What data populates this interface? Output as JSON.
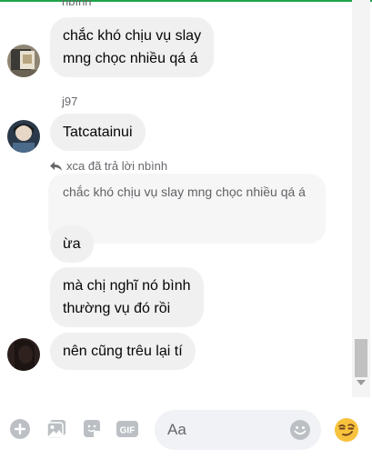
{
  "messages": {
    "top_sender_name": "nbình",
    "bubble_1_line_1": "chắc khó chịu vụ slay",
    "bubble_1_line_2": "mng chọc nhiều qá á",
    "sender_2_name": "j97",
    "bubble_2": "Tatcatainui",
    "reply_label": "xca đã trả lời nbình",
    "quoted_text": "chắc khó chịu vụ slay mng chọc nhiều qá á",
    "bubble_3": "ừa",
    "bubble_4_line_1": "mà chị nghĩ nó bình",
    "bubble_4_line_2": "thường vụ đó rồi",
    "bubble_5": "nên cũng trêu lại tí"
  },
  "composer": {
    "placeholder": "Aa",
    "icons": [
      "plus-circle-icon",
      "image-icon",
      "sticker-icon",
      "gif-icon",
      "smile-icon",
      "smirk-emoji-icon"
    ]
  },
  "scroll": {
    "position_fraction": 0.95
  },
  "colors": {
    "accent": "#1fa34a",
    "bubble": "#f0f0f0",
    "icon_gray": "#bcc0c4"
  }
}
